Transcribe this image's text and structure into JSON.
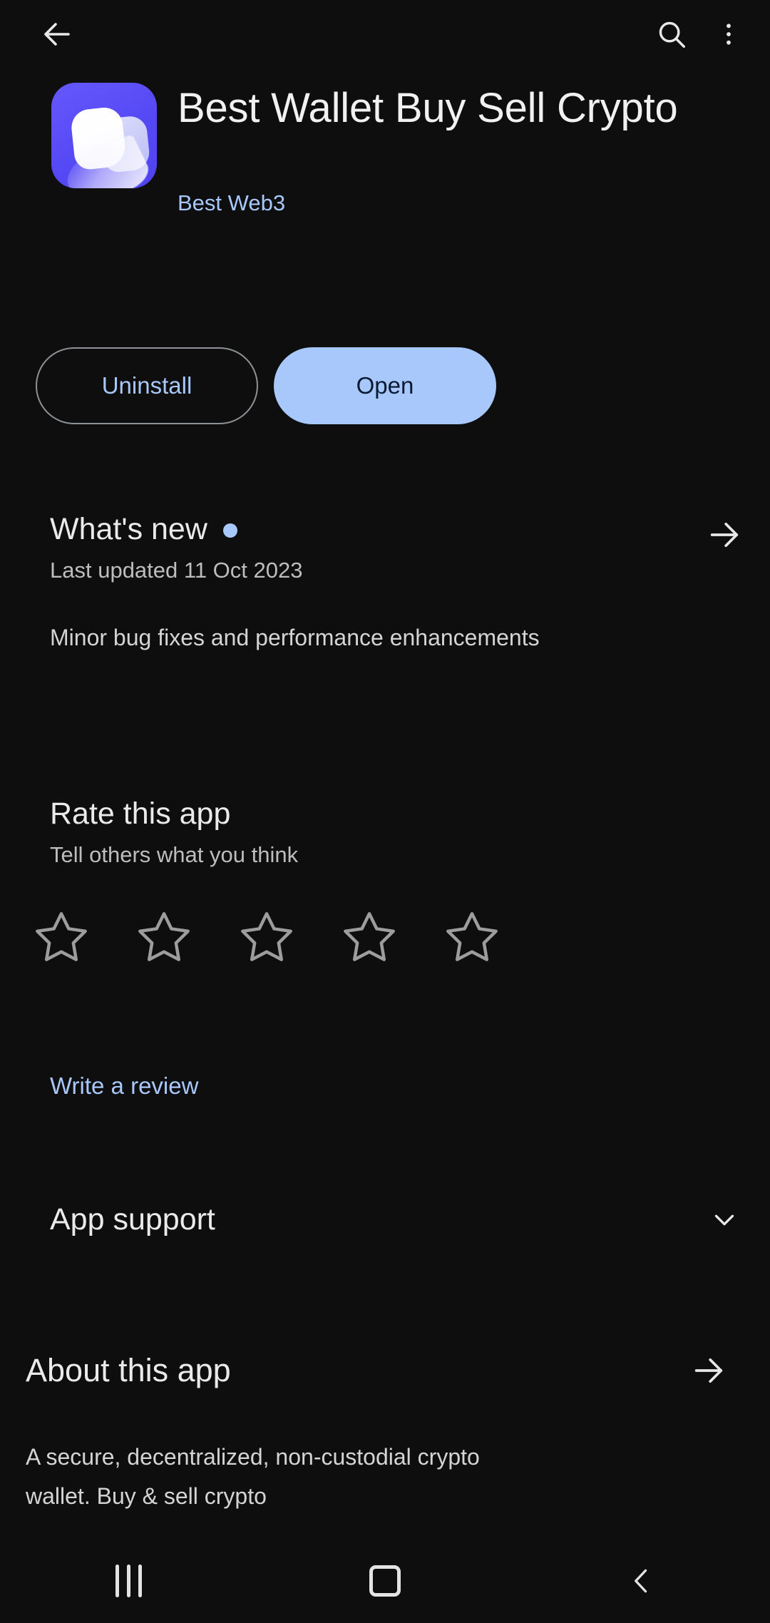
{
  "topbar": {
    "back_icon": "arrow-left-icon",
    "search_icon": "search-icon",
    "overflow_icon": "more-vertical-icon"
  },
  "app": {
    "title": "Best Wallet Buy Sell Crypto",
    "developer": "Best Web3",
    "icon_bg_color": "#5549f5",
    "icon_name": "best-wallet-app-icon"
  },
  "actions": {
    "uninstall_label": "Uninstall",
    "open_label": "Open",
    "open_bg_color": "#a8c7fa",
    "link_color": "#a8c7fa"
  },
  "whats_new": {
    "heading": "What's new",
    "badge_color": "#a8c7fa",
    "last_updated": "Last updated 11 Oct 2023",
    "changelog": "Minor bug fixes and performance enhancements",
    "arrow_icon": "arrow-right-icon"
  },
  "rate": {
    "heading": "Rate this app",
    "subtitle": "Tell others what you think",
    "stars": [
      {
        "index": 1,
        "filled": false
      },
      {
        "index": 2,
        "filled": false
      },
      {
        "index": 3,
        "filled": false
      },
      {
        "index": 4,
        "filled": false
      },
      {
        "index": 5,
        "filled": false
      }
    ],
    "rating_value": 0,
    "write_review_label": "Write a review"
  },
  "app_support": {
    "heading": "App support",
    "expander_icon": "chevron-down-icon",
    "expanded": false
  },
  "about": {
    "heading": "About this app",
    "arrow_icon": "arrow-right-icon",
    "description_line_1": "A secure, decentralized, non-custodial crypto",
    "description_line_2": "wallet. Buy & sell crypto"
  },
  "navbar": {
    "recents_label": "recents-button",
    "home_label": "home-button",
    "back_label": "back-button"
  }
}
